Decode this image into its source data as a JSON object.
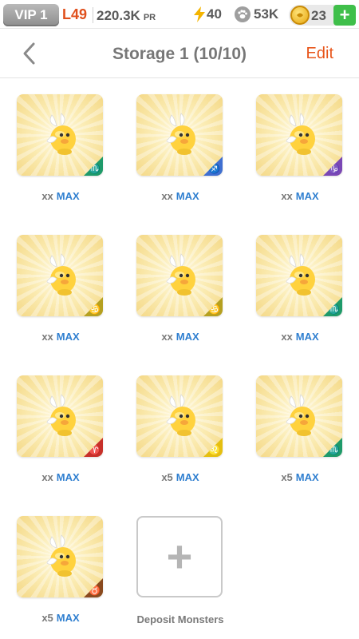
{
  "status": {
    "vip": "VIP 1",
    "level": "L49",
    "power": "220.3K",
    "power_unit": "PR",
    "energy": "40",
    "paw": "53K",
    "coins": "23",
    "add": "+"
  },
  "header": {
    "back_icon": "chevron-left-icon",
    "title": "Storage 1 (10/10)",
    "edit": "Edit"
  },
  "colors": {
    "accent": "#e8561b",
    "max_blue": "#2f7fd0",
    "plus_green": "#3fbf4a"
  },
  "monsters": [
    {
      "count": "xx",
      "max": "MAX",
      "sign": "♏",
      "sign_color": "#1e9a6a"
    },
    {
      "count": "xx",
      "max": "MAX",
      "sign": "♐",
      "sign_color": "#3f6fd1"
    },
    {
      "count": "xx",
      "max": "MAX",
      "sign": "♑",
      "sign_color": "#7a47b5"
    },
    {
      "count": "xx",
      "max": "MAX",
      "sign": "♋",
      "sign_color": "#b5a020"
    },
    {
      "count": "xx",
      "max": "MAX",
      "sign": "♋",
      "sign_color": "#b5a020"
    },
    {
      "count": "xx",
      "max": "MAX",
      "sign": "♏",
      "sign_color": "#1e9a6a"
    },
    {
      "count": "xx",
      "max": "MAX",
      "sign": "♈",
      "sign_color": "#c7302a"
    },
    {
      "count": "x5",
      "max": "MAX",
      "sign": "♌",
      "sign_color": "#e5bf10"
    },
    {
      "count": "x5",
      "max": "MAX",
      "sign": "♏",
      "sign_color": "#1e9a6a"
    },
    {
      "count": "x5",
      "max": "MAX",
      "sign": "♉",
      "sign_color": "#8a4a1f"
    }
  ],
  "deposit": {
    "plus": "+",
    "label": "Deposit Monsters"
  }
}
